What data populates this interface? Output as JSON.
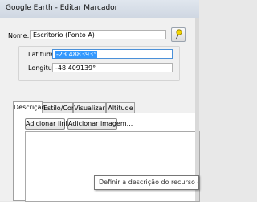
{
  "window": {
    "title": "Google Earth - Editar Marcador"
  },
  "name": {
    "label": "Nome:",
    "value": "Escritorio (Ponto A)"
  },
  "pin_icon": "pushpin-icon",
  "latitude": {
    "label": "Latitude:",
    "value": "-23.488393°"
  },
  "longitude": {
    "label": "Longitude:",
    "value": "-48.409139°"
  },
  "tabs": [
    {
      "label": "Descrição",
      "active": true
    },
    {
      "label": "Estilo/Cor",
      "active": false
    },
    {
      "label": "Visualizar",
      "active": false
    },
    {
      "label": "Altitude",
      "active": false
    }
  ],
  "description": {
    "add_link": "Adicionar link...",
    "add_image": "Adicionar imagem...",
    "text": ""
  },
  "tooltip": "Definir a descrição do recurso que e"
}
